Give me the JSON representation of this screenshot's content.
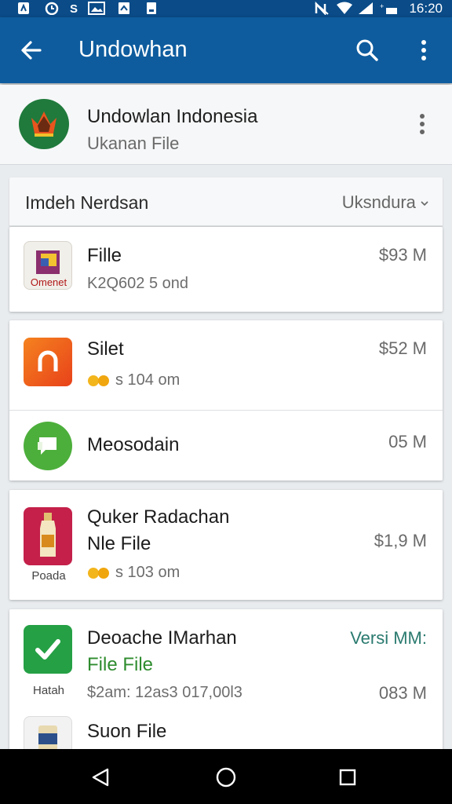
{
  "status_bar": {
    "time": "16:20",
    "icons": [
      "notification-icon",
      "clock-icon",
      "s-icon",
      "image-icon",
      "upload-icon",
      "download-icon",
      "nfc-icon",
      "wifi-icon",
      "signal-icon",
      "battery-icon"
    ]
  },
  "app_bar": {
    "title": "Undowhan",
    "back_icon": "arrow-back-icon",
    "search_icon": "search-icon",
    "more_icon": "more-vert-icon"
  },
  "header": {
    "title": "Undowlan Indonesia",
    "subtitle": "Ukanan File"
  },
  "section": {
    "title": "Imdeh Nerdsan",
    "sort_label": "Uksndura",
    "sort_icon": "chevron-down-icon"
  },
  "items": [
    {
      "name": "Fille",
      "meta": "K2Q602 5 ond",
      "size": "$93 M",
      "icon": "file-box-icon",
      "icon_caption": "Omenet"
    },
    {
      "name": "Silet",
      "meta": "s 104 om",
      "size": "$52 M",
      "icon": "orange-app-icon"
    },
    {
      "name": "Meosodain",
      "meta": "",
      "size": "05 M",
      "icon": "chat-app-icon"
    },
    {
      "name": "Quker Radachan",
      "name2": "Nle File",
      "meta": "s 103 om",
      "size": "$1,9 M",
      "icon": "bottle-icon",
      "icon_caption": "Poada"
    },
    {
      "name": "Deoache IMarhan",
      "name2": "File File",
      "meta": "$2am: 12as3 017,00l3",
      "size_top": "Versi MM:",
      "size": "083 M",
      "icon": "check-icon",
      "icon_caption": "Hatah"
    },
    {
      "name": "Suon File",
      "icon": "can-icon"
    }
  ],
  "nav": {
    "back": "nav-back-icon",
    "home": "nav-home-icon",
    "recents": "nav-recents-icon"
  },
  "colors": {
    "app_bar": "#0e5c9e",
    "status_bar": "#0a4b88",
    "accent_green": "#2e8c2e"
  }
}
